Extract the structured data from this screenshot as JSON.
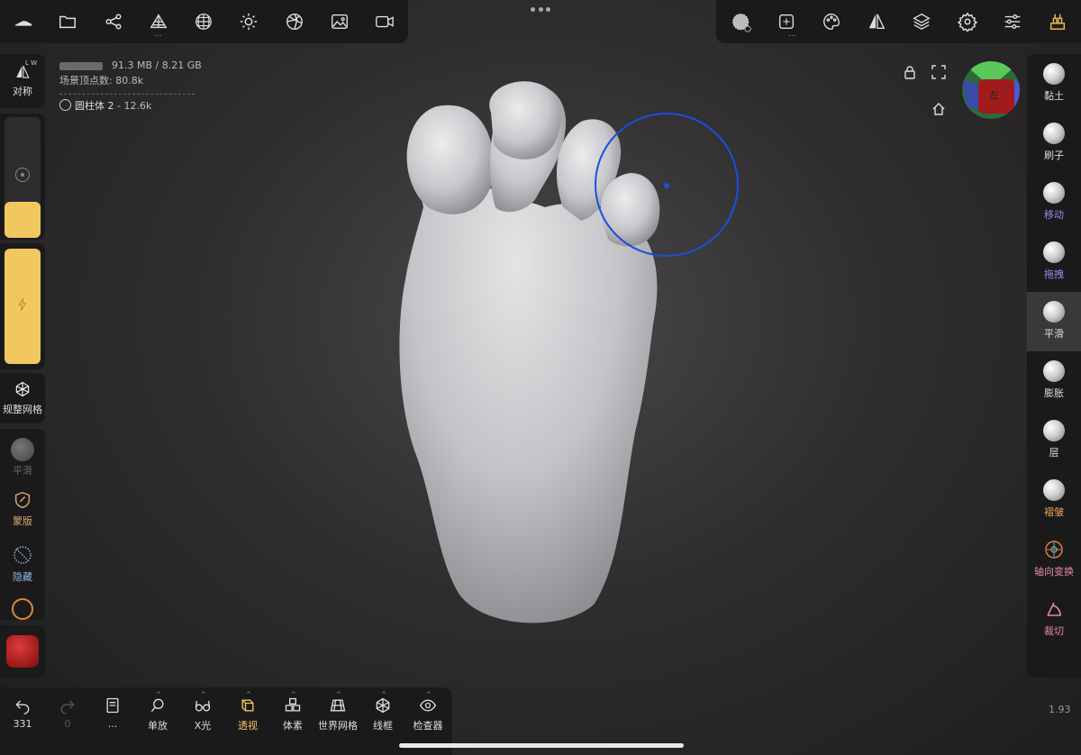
{
  "top_toolbar_left": {
    "icons": [
      "shoe-logo-icon",
      "folder-icon",
      "scene-graph-icon",
      "topology-icon",
      "mesh-sphere-icon",
      "sun-icon",
      "material-ball-icon",
      "image-icon",
      "video-camera-icon"
    ],
    "topology_dots": "..."
  },
  "top_toolbar_right": {
    "icons": [
      "brush-preview-icon",
      "stroke-settings-icon",
      "palette-icon",
      "symmetry-icon",
      "layers-icon",
      "settings-icon",
      "sliders-icon",
      "gold-bars-icon"
    ],
    "stroke_dots": "..."
  },
  "info": {
    "memory": "91.3 MB / 8.21 GB",
    "scene_vertices": "场景顶点数: 80.8k",
    "object_name": "圆柱体 2",
    "object_count": " - 12.6k"
  },
  "left_panel": {
    "symmetry_label": "对称",
    "symmetry_badge": "L W",
    "radius_slider_fraction": 0.3,
    "intensity_slider_fraction": 1.0,
    "remesh_label": "规整网格",
    "smooth_label": "平滑",
    "mask_label": "蒙版",
    "hide_label": "隐藏",
    "accent_color": "#f1c75f"
  },
  "right_tools": [
    {
      "name": "tool-clay",
      "label": "黏土",
      "color": "#dddddd",
      "selected": false
    },
    {
      "name": "tool-brush",
      "label": "刷子",
      "color": "#dddddd",
      "selected": false
    },
    {
      "name": "tool-move",
      "label": "移动",
      "color": "#9a8cf0",
      "selected": false
    },
    {
      "name": "tool-drag",
      "label": "拖拽",
      "color": "#9a8cf0",
      "selected": false
    },
    {
      "name": "tool-smooth",
      "label": "平滑",
      "color": "#dddddd",
      "selected": true
    },
    {
      "name": "tool-inflate",
      "label": "膨胀",
      "color": "#dddddd",
      "selected": false
    },
    {
      "name": "tool-layer",
      "label": "层",
      "color": "#dddddd",
      "selected": false
    },
    {
      "name": "tool-crease",
      "label": "褶皱",
      "color": "#e8a460",
      "selected": false
    },
    {
      "name": "tool-transform",
      "label": "轴向变换",
      "color": "#e48aa0",
      "selected": false
    },
    {
      "name": "tool-trim",
      "label": "裁切",
      "color": "#e48aa0",
      "selected": false
    }
  ],
  "gizmo": {
    "face_label": "左"
  },
  "bottom_toolbar": [
    {
      "name": "undo-button",
      "label": "331",
      "icon": "undo-icon"
    },
    {
      "name": "redo-button",
      "label": "0",
      "icon": "redo-icon"
    },
    {
      "name": "history-button",
      "label": "...",
      "icon": "book-icon"
    },
    {
      "name": "isolate-button",
      "label": "单放",
      "icon": "magnifier-icon"
    },
    {
      "name": "xray-button",
      "label": "X光",
      "icon": "glasses-icon"
    },
    {
      "name": "perspective-button",
      "label": "透视",
      "icon": "cube-persp-icon",
      "active": true
    },
    {
      "name": "voxel-button",
      "label": "体素",
      "icon": "voxel-icon"
    },
    {
      "name": "world-grid-button",
      "label": "世界网格",
      "icon": "grid-floor-icon"
    },
    {
      "name": "wireframe-button",
      "label": "线框",
      "icon": "wireframe-icon"
    },
    {
      "name": "inspector-button",
      "label": "检查器",
      "icon": "eye-icon"
    }
  ],
  "fps": "1.93"
}
